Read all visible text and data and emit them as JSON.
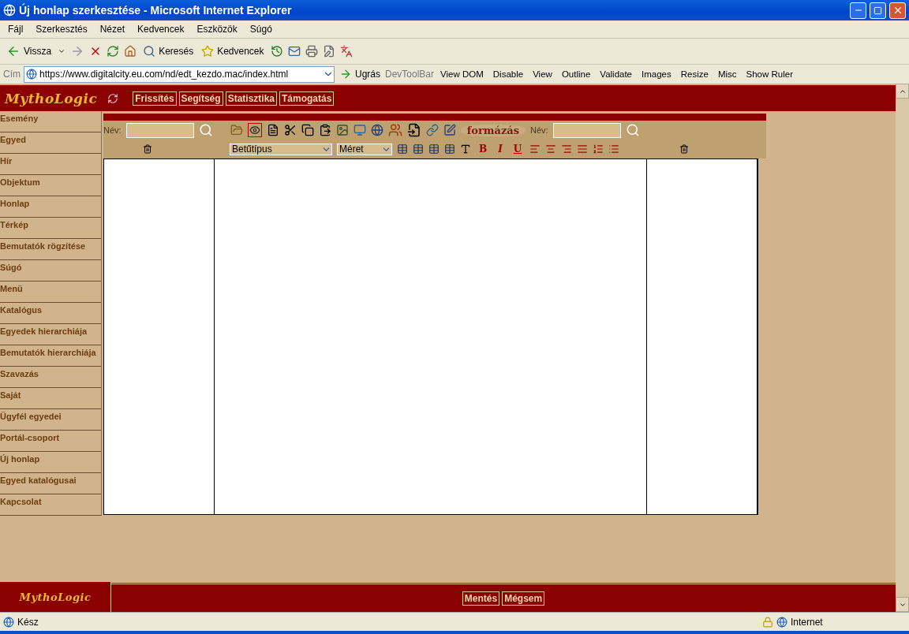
{
  "window": {
    "title": "Új honlap szerkesztése - Microsoft Internet Explorer"
  },
  "menu": [
    "Fájl",
    "Szerkesztés",
    "Nézet",
    "Kedvencek",
    "Eszközök",
    "Súgó"
  ],
  "toolbar": {
    "back": "Vissza",
    "search": "Keresés",
    "favorites": "Kedvencek"
  },
  "address": {
    "label": "Cím",
    "url": "https://www.digitalcity.eu.com/nd/edt_kezdo.mac/index.html",
    "go": "Ugrás"
  },
  "devtoolbar": {
    "label": "DevToolBar",
    "items": [
      "View DOM",
      "Disable",
      "View",
      "Outline",
      "Validate",
      "Images",
      "Resize",
      "Misc",
      "Show Ruler"
    ]
  },
  "site": {
    "logo": "MythoLogic",
    "nav": [
      "Frissítés",
      "Segítség",
      "Statisztika",
      "Támogatás"
    ]
  },
  "sidebar": [
    "Esemény",
    "Egyed",
    "Hír",
    "Objektum",
    "Honlap",
    "Térkép",
    "Bemutatók rögzítése",
    "Súgó",
    "Menü",
    "Katalógus",
    "Egyedek hierarchiája",
    "Bemutatók hierarchiája",
    "Szavazás",
    "Saját",
    "Ügyfél egyedei",
    "Portál-csoport",
    "Új honlap",
    "Egyed katalógusai",
    "Kapcsolat"
  ],
  "editor": {
    "name_label_left": "Név:",
    "name_label_right": "Név:",
    "preview_selected": true,
    "font_select": "Betűtípus",
    "size_select": "Méret",
    "format_label": "formázás",
    "bold": "B",
    "italic": "I",
    "underline": "U"
  },
  "footer": {
    "logo": "MythoLogic",
    "buttons": [
      "Mentés",
      "Mégsem"
    ]
  },
  "status": {
    "text": "Kész",
    "zone": "Internet"
  }
}
